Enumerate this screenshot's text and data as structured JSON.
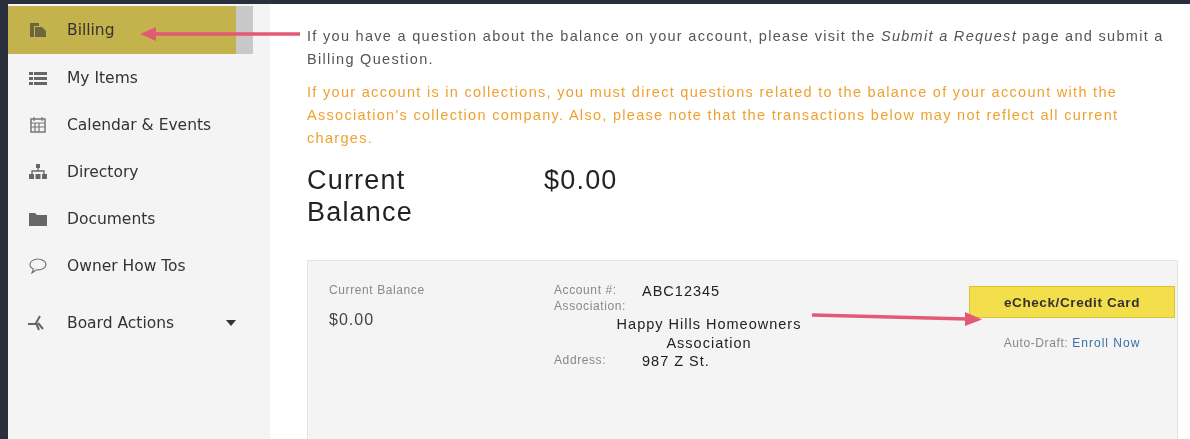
{
  "sidebar": {
    "items": [
      {
        "label": "Billing",
        "selected": true,
        "submenu": false
      },
      {
        "label": "My Items",
        "selected": false,
        "submenu": false
      },
      {
        "label": "Calendar & Events",
        "selected": false,
        "submenu": false
      },
      {
        "label": "Directory",
        "selected": false,
        "submenu": false
      },
      {
        "label": "Documents",
        "selected": false,
        "submenu": false
      },
      {
        "label": "Owner How Tos",
        "selected": false,
        "submenu": false
      },
      {
        "label": "Board Actions",
        "selected": false,
        "submenu": true
      }
    ]
  },
  "notice": "If you have a question about the balance on your account, please visit the *Submit a Request* page and submit a Billing Question.",
  "warning": "If your account is in collections, you must direct questions related to the balance of your account with the Association's collection company. Also, please note that the transactions below may not reflect all current charges.",
  "balance_heading": {
    "label": "Current Balance",
    "value": "$0.00"
  },
  "account_card": {
    "balance_label": "Current Balance",
    "balance_value": "$0.00",
    "fields": [
      {
        "label": "Account #:",
        "value": "ABC12345"
      },
      {
        "label": "Association:",
        "value": "Happy Hills Homeowners Association"
      },
      {
        "label": "Address:",
        "value": "987 Z St."
      }
    ],
    "pay_button": "eCheck/Credit Card",
    "auto_draft_label": "Auto-Draft:",
    "auto_draft_link": "Enroll Now"
  }
}
